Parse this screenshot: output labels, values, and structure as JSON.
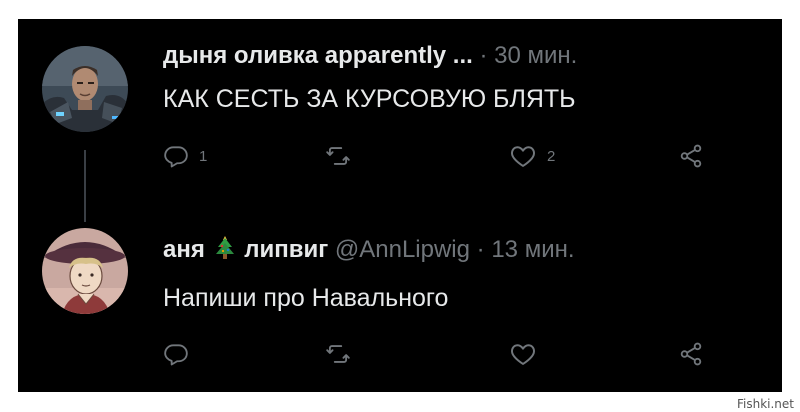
{
  "tweets": [
    {
      "author": "дыня оливка apparently ...",
      "handle": "",
      "separator": "·",
      "time": "30 мин.",
      "text": "КАК СЕСТЬ ЗА КУРСОВУЮ БЛЯТЬ",
      "reply_count": "1",
      "retweet_count": "",
      "like_count": "2"
    },
    {
      "author_part1": "аня",
      "author_emoji": "christmas-tree",
      "author_part2": "липвиг",
      "handle": "@AnnLipwig",
      "separator": "·",
      "time": "13 мин.",
      "text": "Напиши про Навального",
      "reply_count": "",
      "retweet_count": "",
      "like_count": ""
    }
  ],
  "watermark": "Fishki.net",
  "colors": {
    "background": "#000000",
    "text": "#e7e9ea",
    "muted": "#71767b",
    "thread_line": "#3a3f45"
  }
}
